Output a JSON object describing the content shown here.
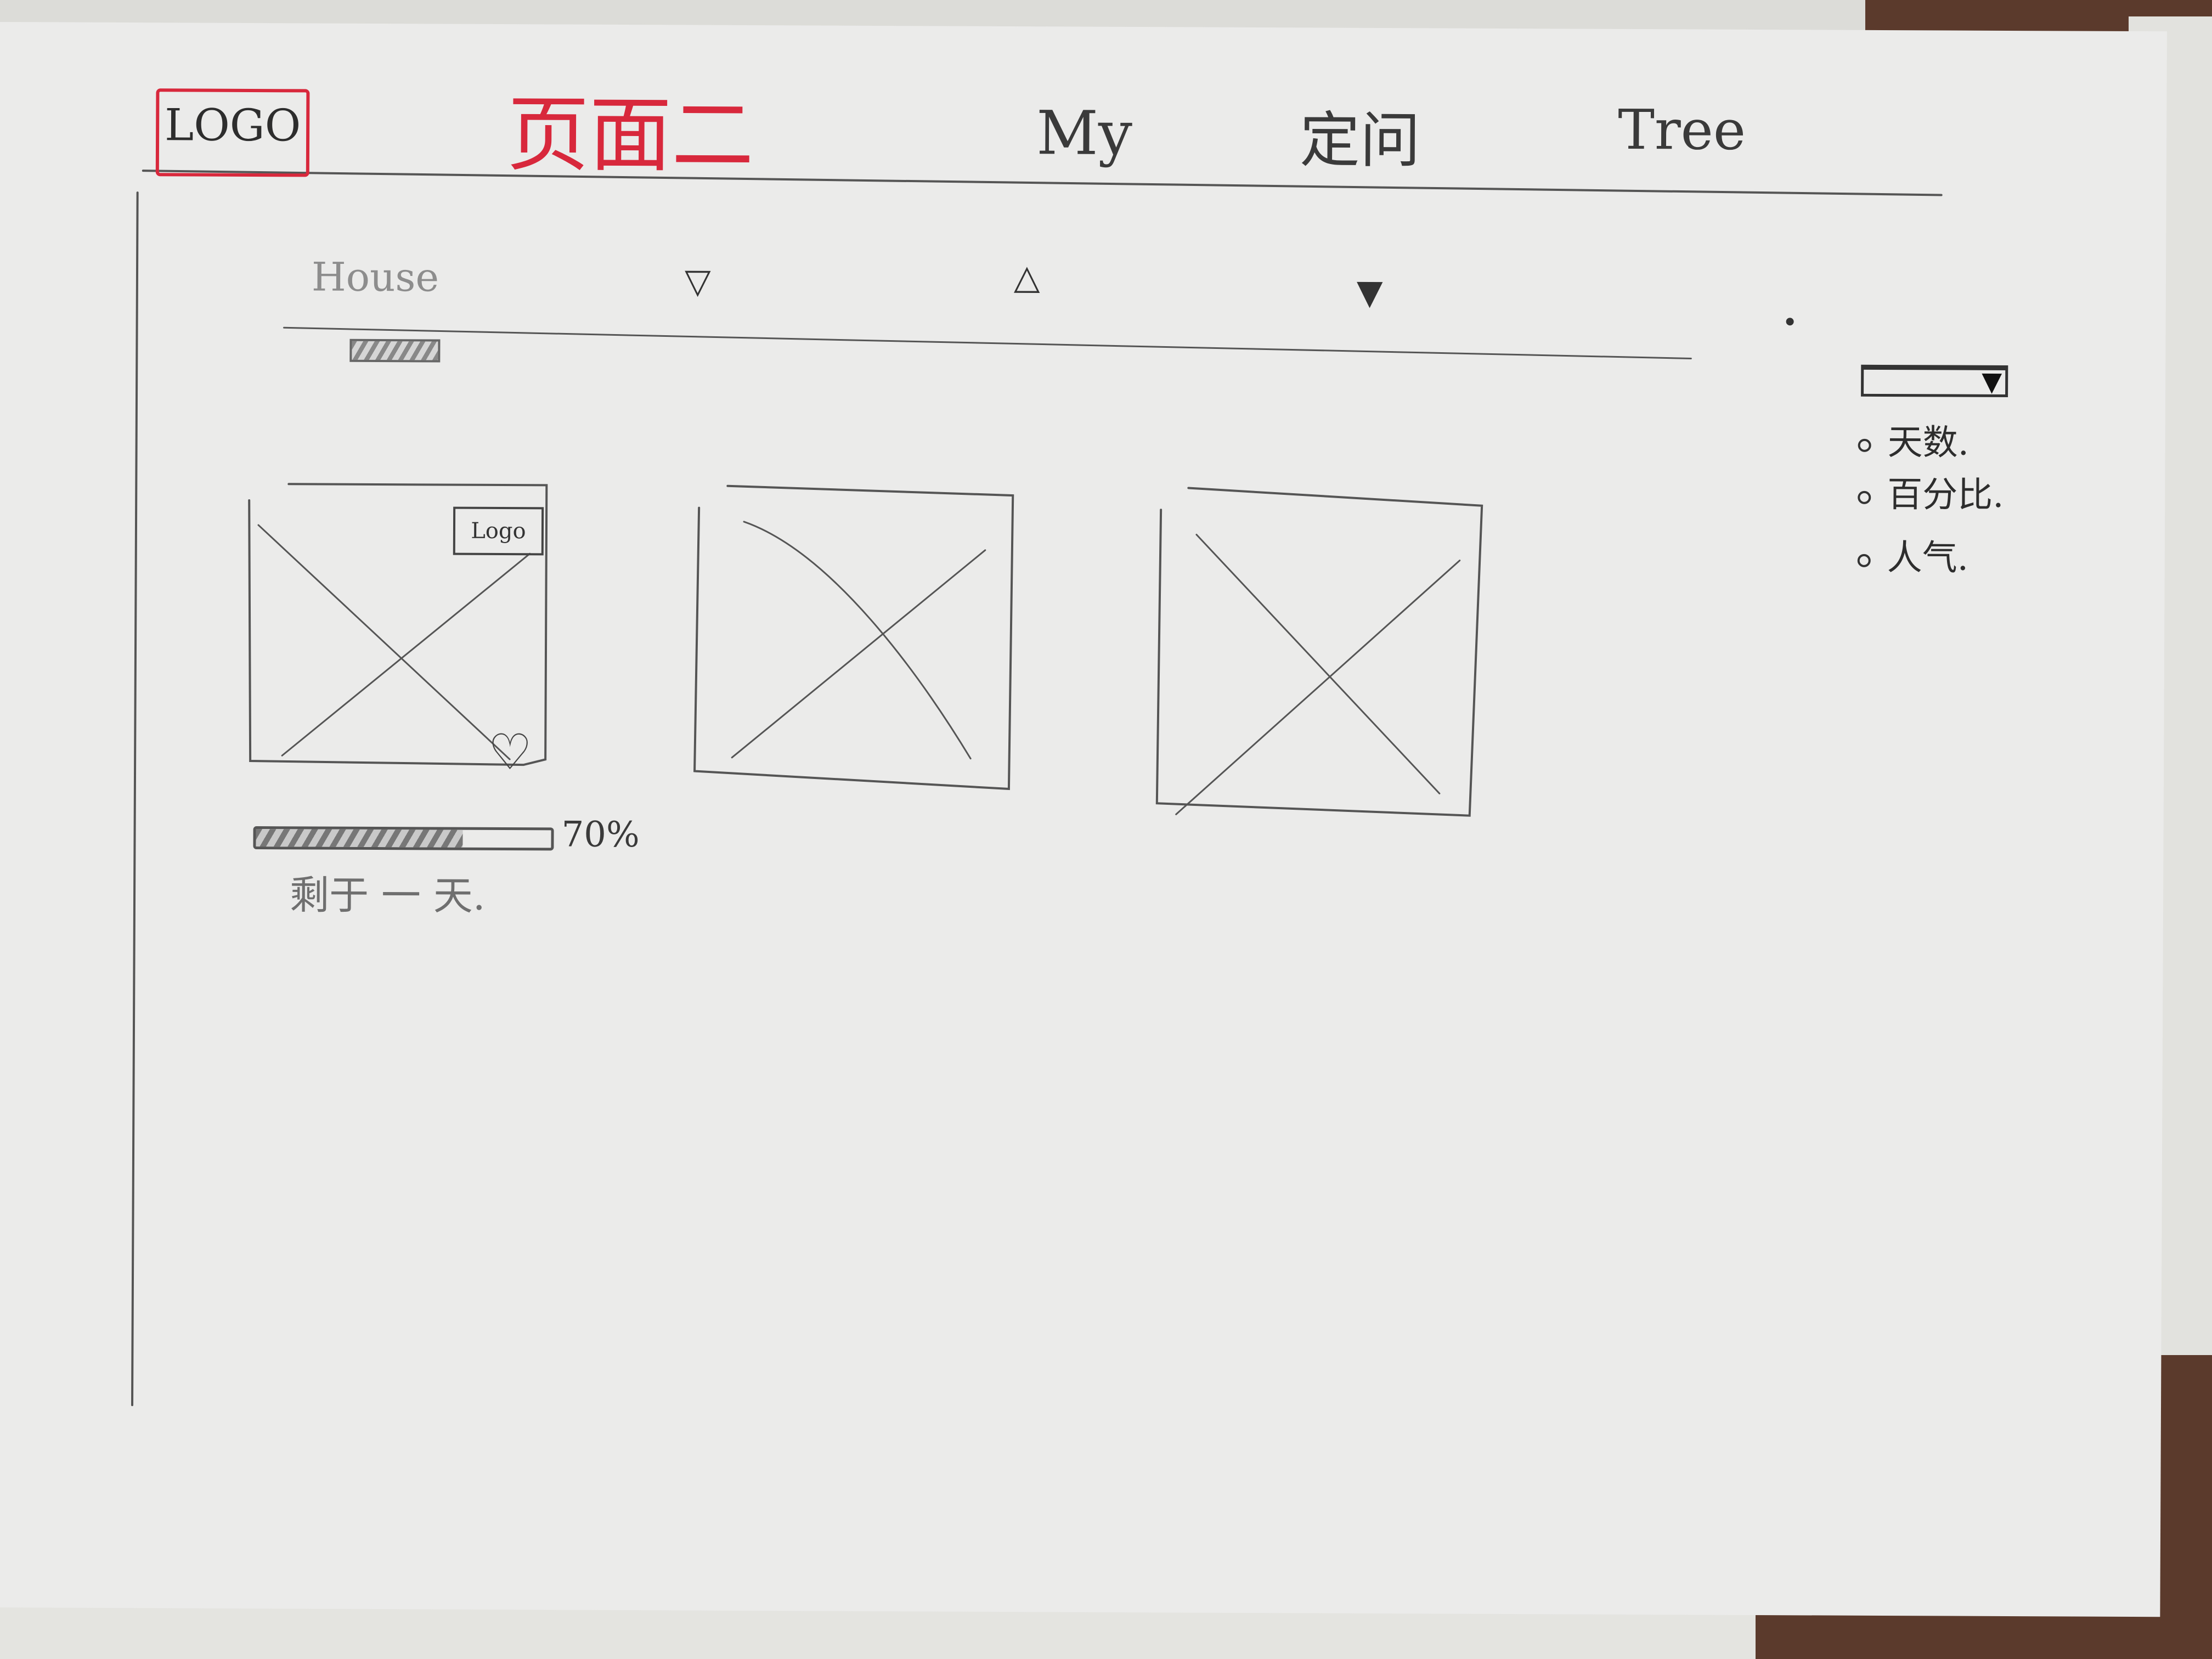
{
  "header": {
    "logo_label": "LOGO",
    "page_title": "页面二",
    "nav": [
      {
        "label": "My"
      },
      {
        "label": "定问"
      },
      {
        "label": "Tree"
      }
    ]
  },
  "filter_bar": {
    "category_label": "House",
    "sort_icons": [
      "triangle-down-icon",
      "triangle-up-icon",
      "triangle-down-filled-icon"
    ]
  },
  "sidebar": {
    "dropdown_arrow": "▼",
    "options": [
      {
        "label": "天数."
      },
      {
        "label": "百分比."
      },
      {
        "label": "人气."
      }
    ]
  },
  "cards": [
    {
      "logo_label": "Logo",
      "heart_icon": "heart-icon",
      "progress": {
        "percent": 70,
        "label": "70%"
      },
      "remaining_label": "剩于 一 天."
    },
    {},
    {}
  ],
  "colors": {
    "title_red": "#d8283c",
    "pencil": "#555555",
    "paper": "#ebebea"
  }
}
